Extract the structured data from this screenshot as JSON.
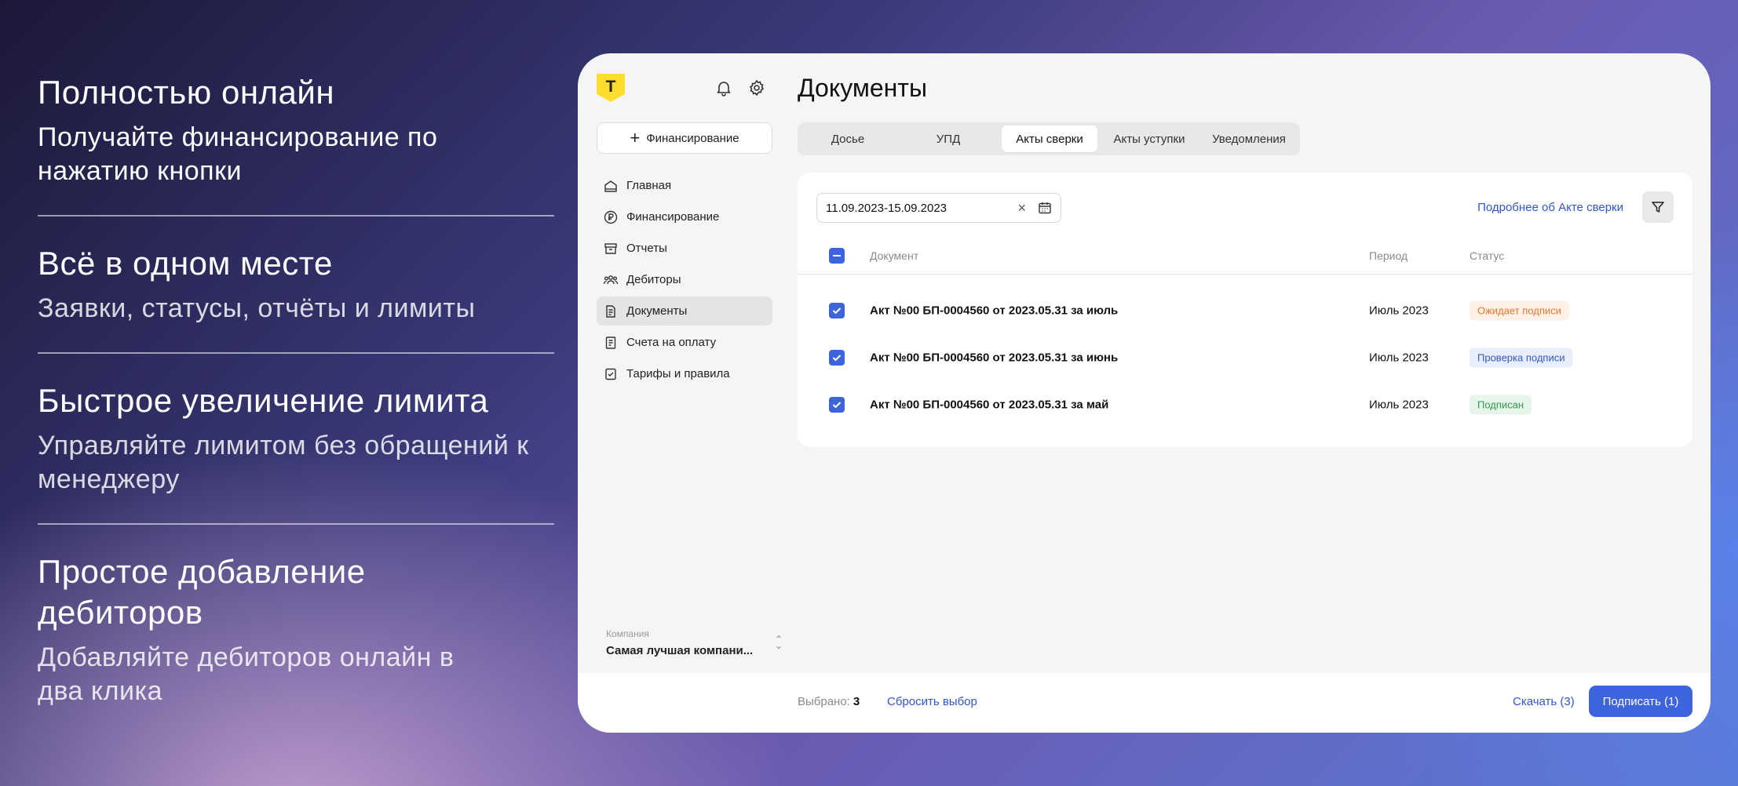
{
  "features": [
    {
      "title": "Полностью онлайн",
      "text": "Получайте финансирование по нажатию кнопки"
    },
    {
      "title": "Всё в одном месте",
      "text": "Заявки, статусы, отчёты и лимиты"
    },
    {
      "title": "Быстрое увеличение лимита",
      "text": "Управляйте лимитом без обращений к менеджеру"
    },
    {
      "title": "Простое добавление дебиторов",
      "text": "Добавляйте дебиторов онлайн в два клика"
    }
  ],
  "sidebar": {
    "logo": "Т",
    "finance_button": "Финансирование",
    "items": [
      {
        "label": "Главная",
        "icon": "home-icon"
      },
      {
        "label": "Финансирование",
        "icon": "ruble-icon"
      },
      {
        "label": "Отчеты",
        "icon": "archive-icon"
      },
      {
        "label": "Дебиторы",
        "icon": "people-icon"
      },
      {
        "label": "Документы",
        "icon": "document-icon",
        "active": true
      },
      {
        "label": "Счета на оплату",
        "icon": "invoice-icon"
      },
      {
        "label": "Тарифы и правила",
        "icon": "rules-icon"
      }
    ],
    "company_label": "Компания",
    "company_name": "Самая лучшая компани..."
  },
  "main": {
    "title": "Документы",
    "tabs": [
      {
        "label": "Досье"
      },
      {
        "label": "УПД"
      },
      {
        "label": "Акты сверки",
        "active": true
      },
      {
        "label": "Акты уступки"
      },
      {
        "label": "Уведомления"
      }
    ],
    "date_range": "11.09.2023-15.09.2023",
    "more_link": "Подробнее об Акте сверки",
    "columns": [
      "Документ",
      "Период",
      "Статус"
    ],
    "rows": [
      {
        "document": "Акт №00 БП-0004560 от 2023.05.31 за июль",
        "period": "Июль 2023",
        "status": "Ожидает подписи"
      },
      {
        "document": "Акт №00 БП-0004560 от 2023.05.31 за июнь",
        "period": "Июль 2023",
        "status": "Проверка подписи"
      },
      {
        "document": "Акт №00 БП-0004560 от 2023.05.31 за май",
        "period": "Июль 2023",
        "status": "Подписан"
      }
    ]
  },
  "footer": {
    "selected_label": "Выбрано:",
    "selected_count": "3",
    "reset": "Сбросить выбор",
    "download": "Скачать (3)",
    "sign": "Подписать (1)"
  },
  "colors": {
    "accent": "#3d63dd",
    "link": "#2f55d4",
    "logo": "#ffdd2d",
    "status_waiting": "#fff1e6",
    "status_waiting_text": "#e8772e",
    "status_check": "#e8eefc",
    "status_check_text": "#3556c9",
    "status_signed": "#e6f6ea",
    "status_signed_text": "#2f9a4a"
  }
}
